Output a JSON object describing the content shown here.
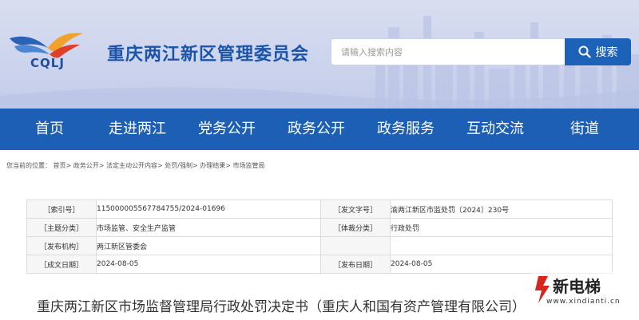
{
  "header": {
    "logo_text": "CQLJ",
    "site_title": "重庆两江新区管理委员会",
    "search": {
      "placeholder": "请输入搜索内容",
      "button_label": "搜索"
    }
  },
  "nav": {
    "items": [
      {
        "label": "首页"
      },
      {
        "label": "走进两江"
      },
      {
        "label": "党务公开"
      },
      {
        "label": "政务公开"
      },
      {
        "label": "政务服务"
      },
      {
        "label": "互动交流"
      },
      {
        "label": "街道"
      }
    ]
  },
  "breadcrumb": {
    "prefix": "您当前的位置：",
    "items": [
      "首页",
      "政务公开",
      "法定主动公开内容",
      "处罚/强制",
      "办理结果",
      "市场监管局"
    ],
    "separator": ">"
  },
  "info_table": {
    "rows": [
      {
        "label1": "［索引号］",
        "value1": "115000005567784755/2024-01696",
        "label2": "［发文字号］",
        "value2": "渝两江新区市监处罚〔2024〕230号"
      },
      {
        "label1": "［主题分类］",
        "value1": "市场监管、安全生产监管",
        "label2": "［体裁分类］",
        "value2": "行政处罚"
      },
      {
        "label1": "［发布机构］",
        "value1": "两江新区管委会",
        "label2": "",
        "value2": ""
      },
      {
        "label1": "［成文日期］",
        "value1": "2024-08-05",
        "label2": "［发布日期］",
        "value2": "2024-08-05"
      }
    ]
  },
  "document": {
    "title": "重庆两江新区市场监督管理局行政处罚决定书（重庆人和国有资产管理有限公司）"
  },
  "watermark": {
    "brand": "新电梯",
    "url": "www.xindianti.cn"
  },
  "colors": {
    "nav_bg": "#1c5fb5",
    "search_button": "#1c62b9",
    "title_blue": "#1c55a8",
    "watermark_red": "#d7261e"
  }
}
